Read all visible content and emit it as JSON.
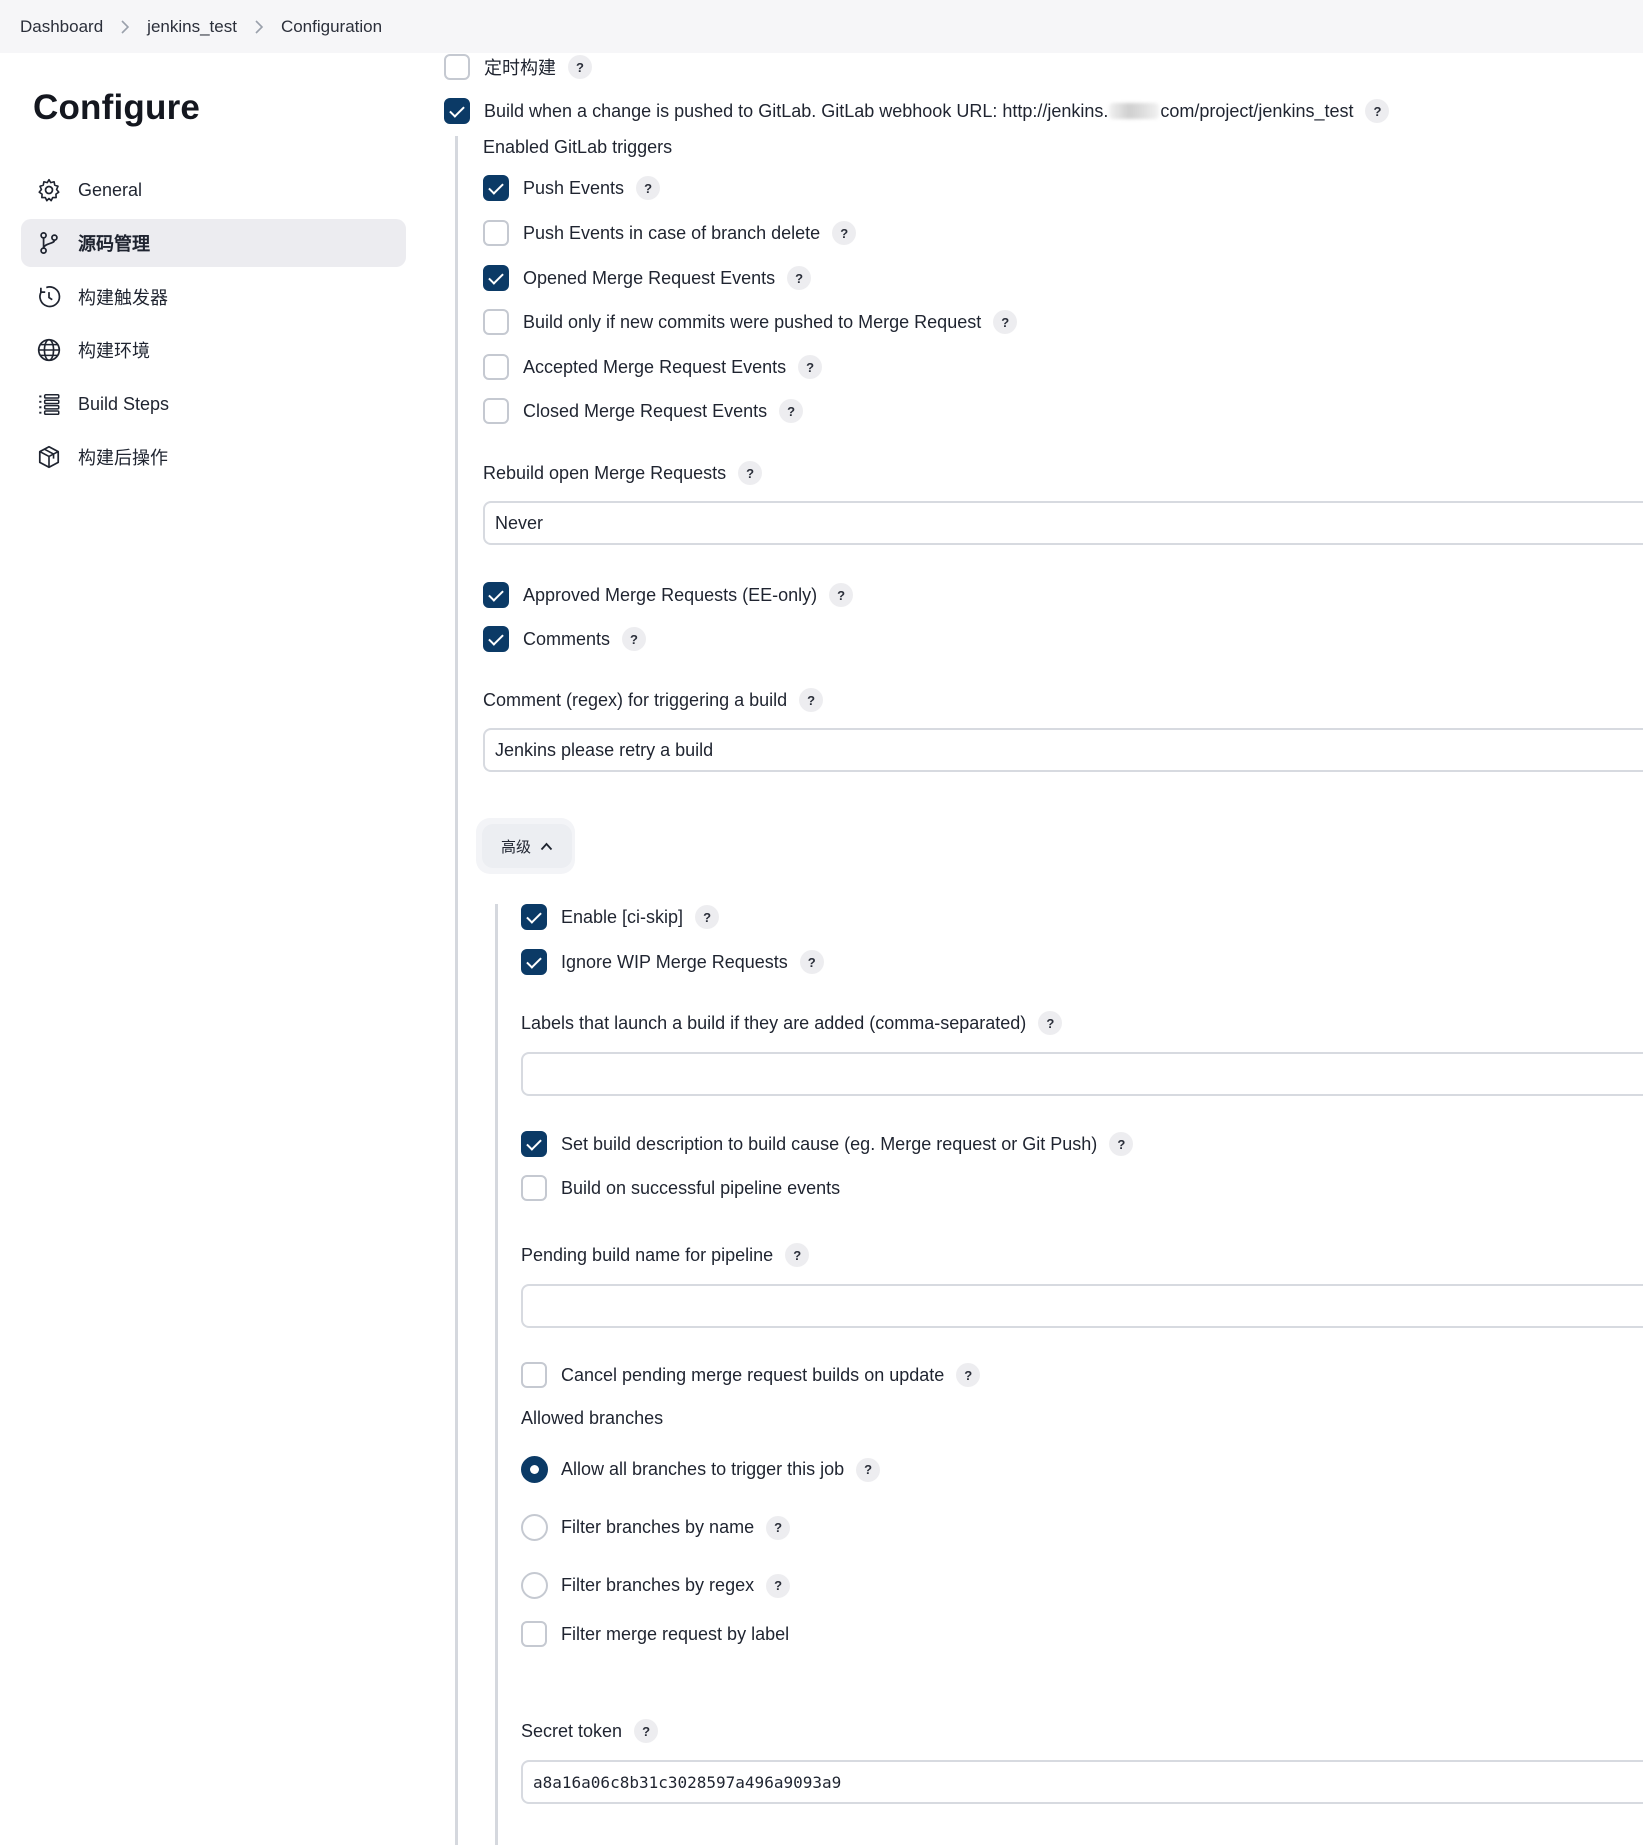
{
  "breadcrumb": [
    "Dashboard",
    "jenkins_test",
    "Configuration"
  ],
  "sidebar": {
    "title": "Configure",
    "items": [
      {
        "label": "General",
        "icon": "gear-icon"
      },
      {
        "label": "源码管理",
        "icon": "branch-icon",
        "active": true
      },
      {
        "label": "构建触发器",
        "icon": "clock-icon"
      },
      {
        "label": "构建环境",
        "icon": "globe-icon"
      },
      {
        "label": "Build Steps",
        "icon": "list-icon"
      },
      {
        "label": "构建后操作",
        "icon": "cube-icon"
      }
    ]
  },
  "triggers": {
    "timed_build": {
      "label": "定时构建",
      "checked": false
    },
    "gitlab_push": {
      "label_prefix": "Build when a change is pushed to GitLab. GitLab webhook URL: http://jenkins.",
      "label_suffix": "com/project/jenkins_test",
      "checked": true
    },
    "enabled_title": "Enabled GitLab triggers",
    "options": [
      {
        "label": "Push Events",
        "checked": true
      },
      {
        "label": "Push Events in case of branch delete",
        "checked": false
      },
      {
        "label": "Opened Merge Request Events",
        "checked": true
      },
      {
        "label": "Build only if new commits were pushed to Merge Request",
        "checked": false
      },
      {
        "label": "Accepted Merge Request Events",
        "checked": false
      },
      {
        "label": "Closed Merge Request Events",
        "checked": false
      }
    ],
    "rebuild_label": "Rebuild open Merge Requests",
    "rebuild_value": "Never",
    "approved": {
      "label": "Approved Merge Requests (EE-only)",
      "checked": true
    },
    "comments": {
      "label": "Comments",
      "checked": true
    },
    "comment_regex_label": "Comment (regex) for triggering a build",
    "comment_regex_value": "Jenkins please retry a build"
  },
  "advanced": {
    "button_label": "高级",
    "ci_skip": {
      "label": "Enable [ci-skip]",
      "checked": true
    },
    "ignore_wip": {
      "label": "Ignore WIP Merge Requests",
      "checked": true
    },
    "labels_field_label": "Labels that launch a build if they are added (comma-separated)",
    "labels_field_value": "",
    "set_desc": {
      "label": "Set build description to build cause (eg. Merge request or Git Push)",
      "checked": true
    },
    "pipeline_events": {
      "label": "Build on successful pipeline events",
      "checked": false
    },
    "pending_name_label": "Pending build name for pipeline",
    "pending_name_value": "",
    "cancel_pending": {
      "label": "Cancel pending merge request builds on update",
      "checked": false
    },
    "allowed_branches_label": "Allowed branches",
    "branch_options": [
      {
        "label": "Allow all branches to trigger this job",
        "checked": true
      },
      {
        "label": "Filter branches by name",
        "checked": false
      },
      {
        "label": "Filter branches by regex",
        "checked": false
      }
    ],
    "filter_label": {
      "label": "Filter merge request by label",
      "checked": false
    },
    "secret_token_label": "Secret token",
    "secret_token_value": "a8a16a06c8b31c3028597a496a9093a9"
  },
  "help_mark": "?",
  "colors": {
    "accent": "#0b3a66",
    "border": "#d7dae0",
    "sidebar_active": "#ececf0"
  }
}
